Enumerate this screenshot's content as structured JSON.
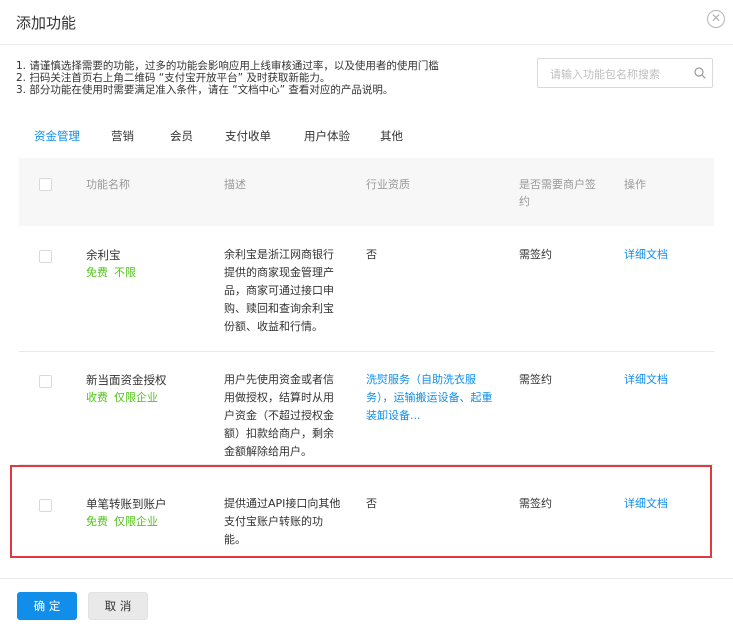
{
  "dialog": {
    "title": "添加功能",
    "close_icon": "close-circle-icon"
  },
  "notes": [
    "1. 请谨慎选择需要的功能，过多的功能会影响应用上线审核通过率，以及使用者的使用门槛",
    "2. 扫码关注首页右上角二维码 “支付宝开放平台” 及时获取新能力。",
    "3. 部分功能在使用时需要满足准入条件，请在 “文档中心” 查看对应的产品说明。"
  ],
  "search": {
    "placeholder": "请输入功能包名称搜索",
    "value": "",
    "icon": "search-icon"
  },
  "tabs": [
    {
      "label": "资金管理",
      "active": true
    },
    {
      "label": "营销",
      "active": false
    },
    {
      "label": "会员",
      "active": false
    },
    {
      "label": "支付收单",
      "active": false
    },
    {
      "label": "用户体验",
      "active": false
    },
    {
      "label": "其他",
      "active": false
    }
  ],
  "table": {
    "headers": [
      "功能名称",
      "描述",
      "行业资质",
      "是否需要商户签约",
      "操作"
    ],
    "rows": [
      {
        "name": "余利宝",
        "price": "免费",
        "scope": "不限",
        "description": "余利宝是浙江网商银行提供的商家现金管理产品，商家可通过接口申购、赎回和查询余利宝份额、收益和行情。",
        "qualification": "否",
        "qualification_is_link": false,
        "sign": "需签约",
        "action": "详细文档"
      },
      {
        "name": "新当面资金授权",
        "price": "收费",
        "scope": "仅限企业",
        "description": "用户先使用资金或者信用做授权，结算时从用户资金（不超过授权金额）扣款给商户，剩余金额解除给用户。",
        "qualification": "洗熨服务（自助洗衣服务），运输搬运设备、起重装卸设备...",
        "qualification_is_link": true,
        "sign": "需签约",
        "action": "详细文档"
      },
      {
        "name": "单笔转账到账户",
        "price": "免费",
        "scope": "仅限企业",
        "description": "提供通过API接口向其他支付宝账户转账的功能。",
        "qualification": "否",
        "qualification_is_link": false,
        "sign": "需签约",
        "action": "详细文档"
      }
    ]
  },
  "footer": {
    "confirm_label": "确 定",
    "cancel_label": "取 消"
  },
  "colors": {
    "accent": "#108ee9",
    "price_green": "#52c41a",
    "highlight_red": "#e0393e"
  }
}
